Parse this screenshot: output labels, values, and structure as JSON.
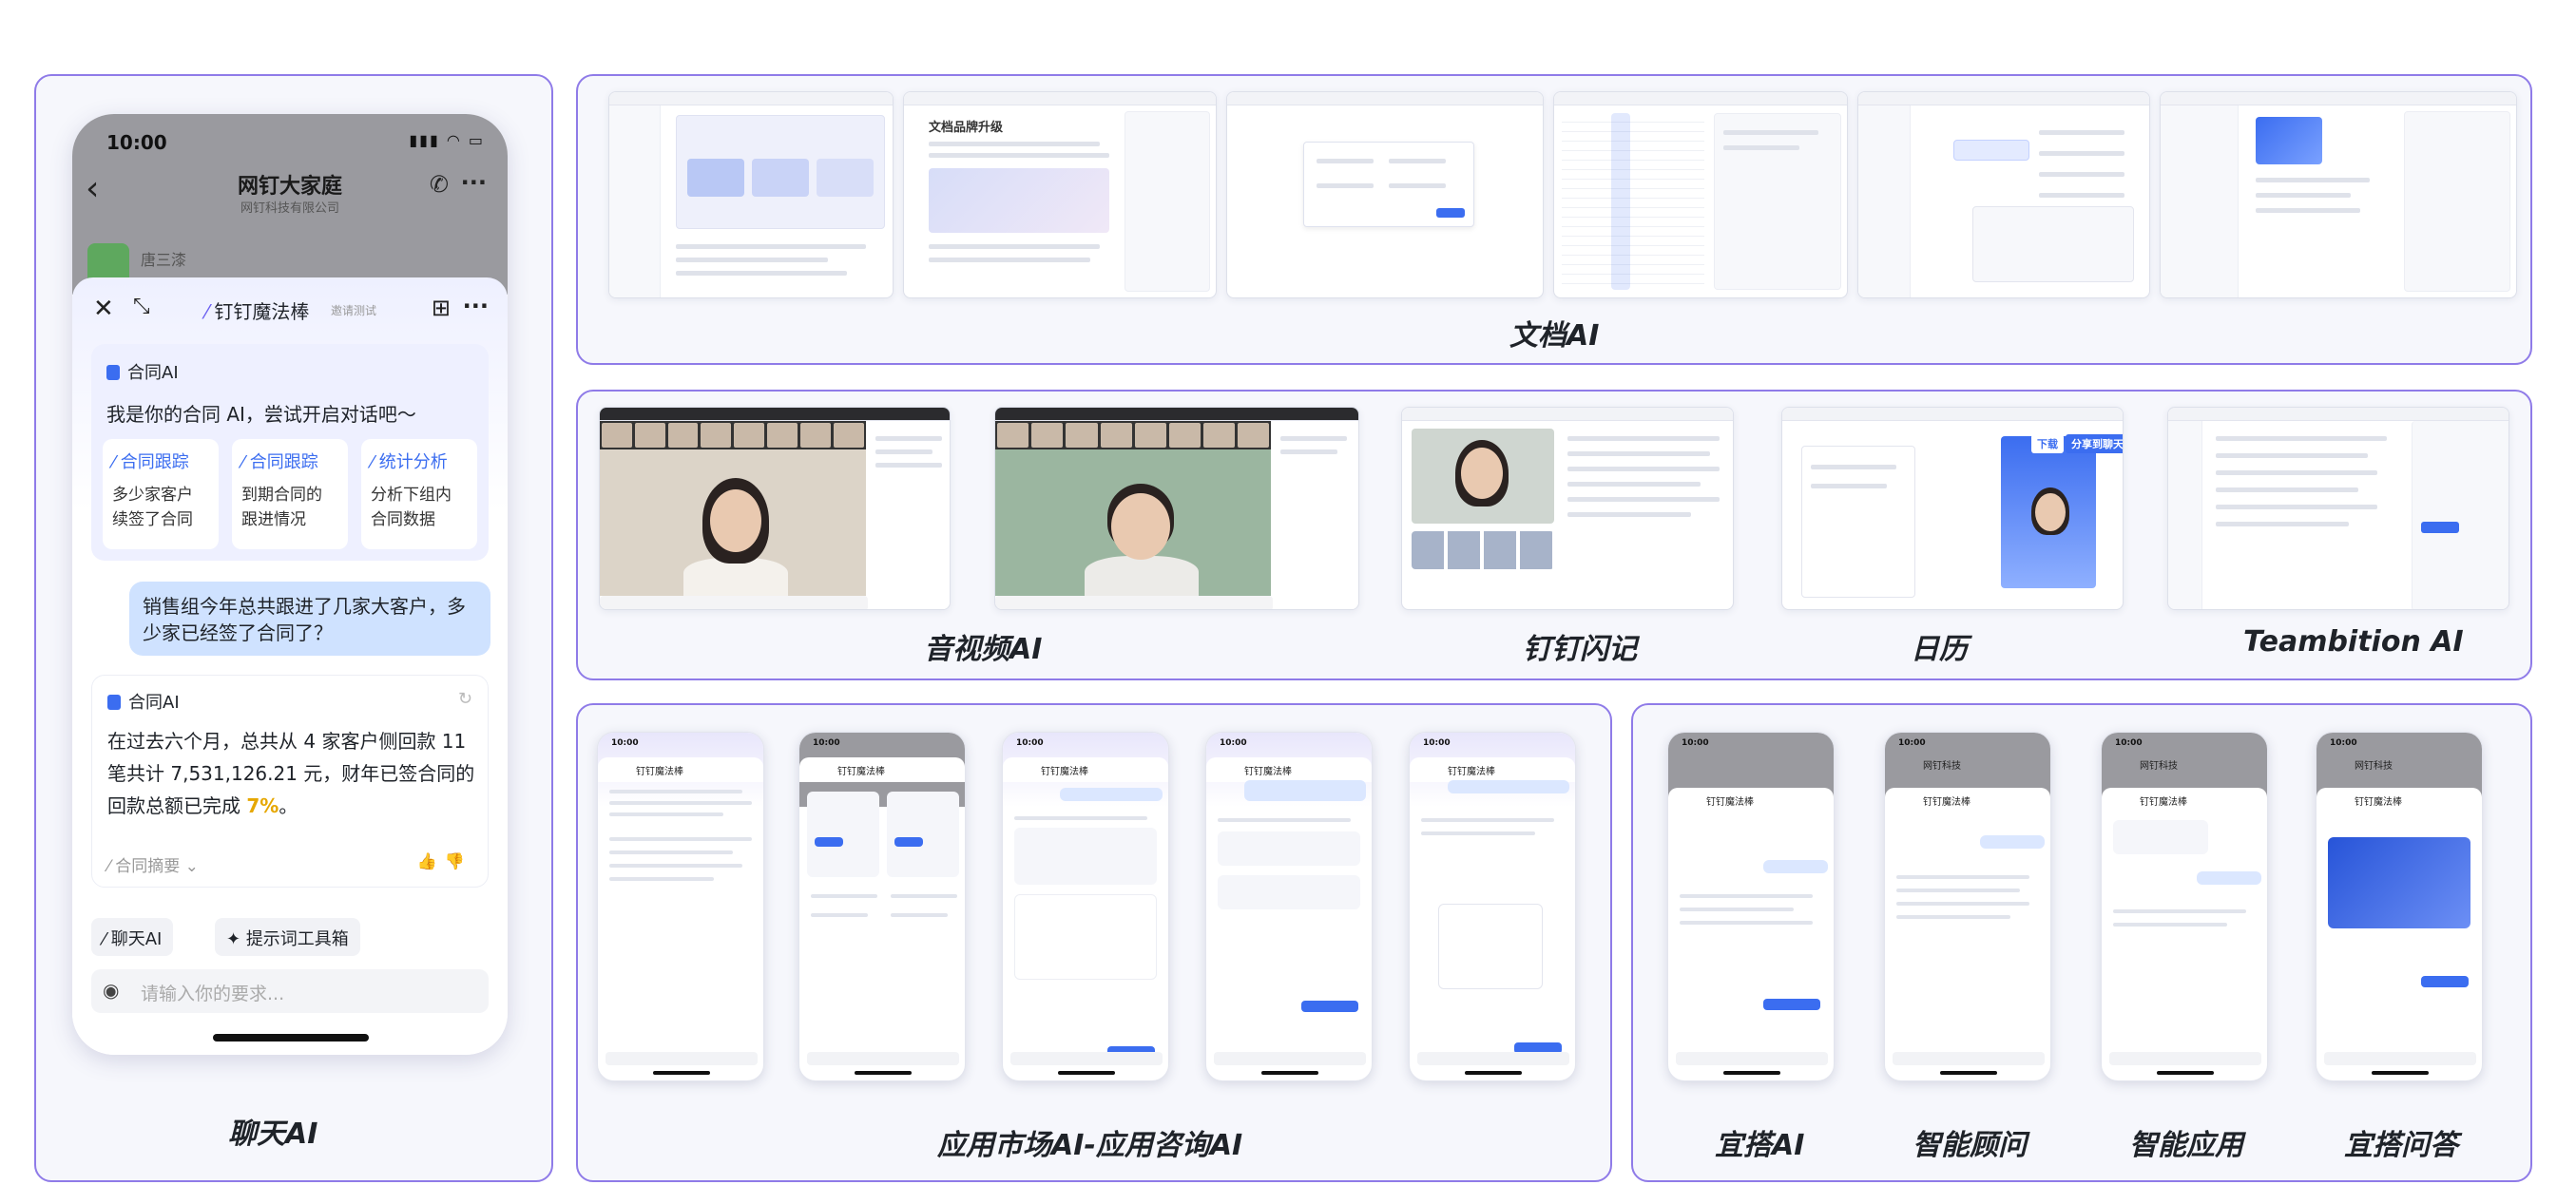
{
  "chat_panel": {
    "caption": "聊天AI",
    "phone": {
      "time": "10:00",
      "chat_title": "网钉大家庭",
      "chat_subtitle": "网钉科技有限公司",
      "sender_name": "唐三漆",
      "sheet_title": "钉钉魔法棒",
      "sheet_badge": "邀请测试",
      "welcome_card": {
        "tag": "合同AI",
        "greeting": "我是你的合同 AI，尝试开启对话吧～",
        "suggestions": [
          {
            "title": "合同跟踪",
            "body_line1": "多少家客户",
            "body_line2": "续签了合同"
          },
          {
            "title": "合同跟踪",
            "body_line1": "到期合同的",
            "body_line2": "跟进情况"
          },
          {
            "title": "统计分析",
            "body_line1": "分析下组内",
            "body_line2": "合同数据"
          }
        ]
      },
      "user_message": "销售组今年总共跟进了几家大客户，多少家已经签了合同了？",
      "answer_card": {
        "tag": "合同AI",
        "answer_prefix": "在过去六个月，总共从 4 家客户侧回款 11 笔共计 7,531,126.21 元，财年已签合同的回款总额已完成 ",
        "answer_pct": "7%",
        "answer_suffix": "。",
        "summary_label": "合同摘要"
      },
      "chips": [
        "聊天AI",
        "提示词工具箱"
      ],
      "input_placeholder": "请输入你的要求..."
    }
  },
  "captions": {
    "doc": "文档AI",
    "av": "音视频AI",
    "flash": "钉钉闪记",
    "calendar": "日历",
    "teambition": "Teambition AI",
    "market": "应用市场AI-应用咨询AI",
    "yida": "宜搭AI",
    "advisor": "智能顾问",
    "smart_app": "智能应用",
    "yida_qa": "宜搭问答"
  },
  "doc_screens": {
    "doc_title": "文档品牌升级"
  },
  "calendar_screen": {
    "button1": "下载",
    "button2": "分享到聊天"
  },
  "small_phones": {
    "time": "10:00",
    "magic_title": "钉钉魔法棒",
    "company_title": "网钉科技"
  },
  "colors": {
    "panel_border": "#8f7be8",
    "accent_blue": "#3b6df0",
    "user_bubble": "#cfe2ff",
    "highlight": "#e6a700"
  }
}
